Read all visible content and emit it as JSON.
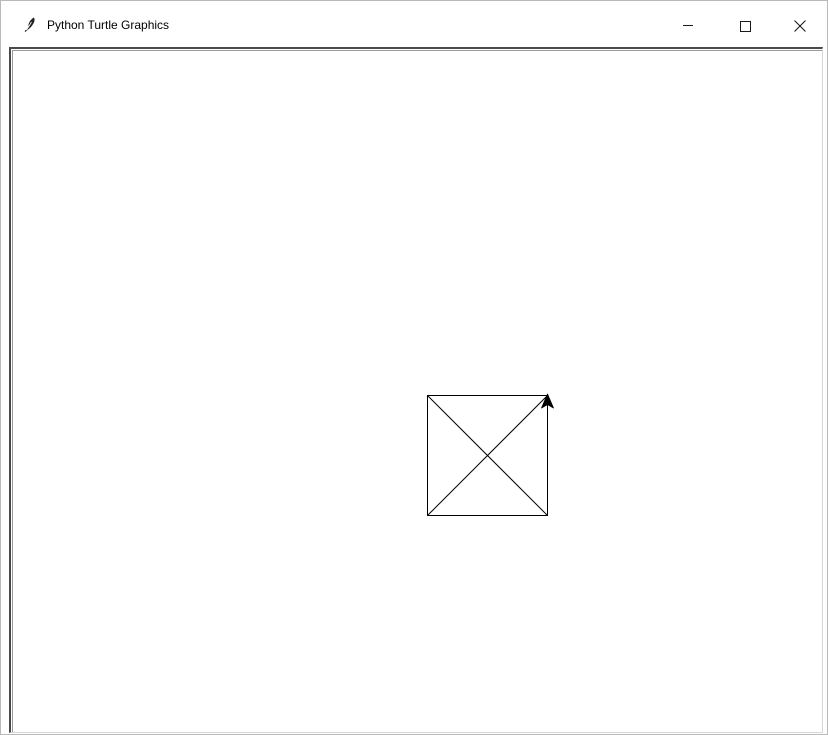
{
  "window": {
    "title": "Python Turtle Graphics",
    "app_icon": "feather-icon",
    "controls": {
      "minimize_icon": "minimize-icon",
      "maximize_icon": "maximize-icon",
      "close_icon": "close-icon"
    }
  },
  "canvas": {
    "background": "#ffffff",
    "pen_color": "#000000",
    "drawing": {
      "shape": "square-with-diagonals",
      "turtle_icon": "turtle-arrow-icon",
      "turtle_heading": "north"
    }
  }
}
